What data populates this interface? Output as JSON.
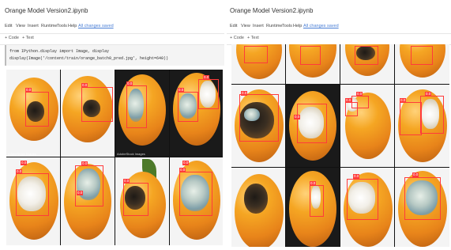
{
  "left_window": {
    "title": "Orange Model Version2.ipynb",
    "menu": [
      "Edit",
      "View",
      "Insert",
      "Runtime",
      "Tools",
      "Help"
    ],
    "saved_status": "All changes saved",
    "toolbar": [
      "+ Code",
      "+ Text"
    ],
    "code_lines": [
      "from IPython.display import Image, display",
      "display(Image('/content/train/orange_batch0_pred.jpg', height=640))"
    ],
    "detection_label": "0.0",
    "watermark": "AdobeStock Images"
  },
  "right_window": {
    "title": "Orange Model Version2.ipynb",
    "menu": [
      "Edit",
      "View",
      "Insert",
      "Runtime",
      "Tools",
      "Help"
    ],
    "saved_status": "All changes saved",
    "toolbar": [
      "+ Code",
      "+ Text"
    ],
    "detection_label": "0.0"
  },
  "icons": {
    "star": "star-icon"
  },
  "colors": {
    "bbox": "#ff3b3b",
    "link": "#4a7fd6"
  }
}
